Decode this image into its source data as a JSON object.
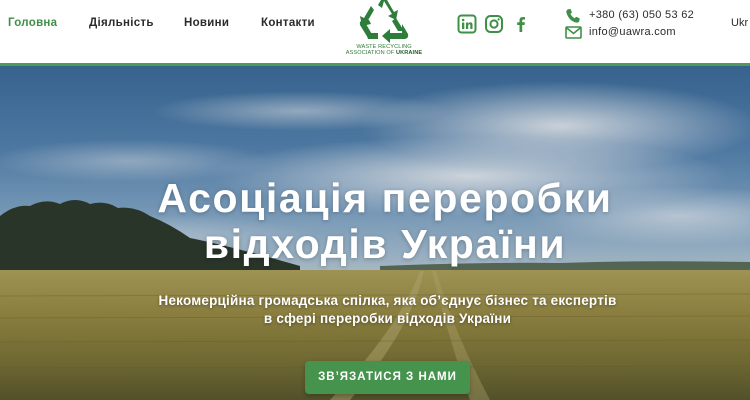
{
  "nav": {
    "items": [
      {
        "label": "Головна"
      },
      {
        "label": "Діяльність"
      },
      {
        "label": "Новини"
      },
      {
        "label": "Контакти"
      }
    ],
    "active_index": 0
  },
  "logo": {
    "line1": "WASTE RECYCLING",
    "line2_prefix": "ASSOCIATION OF",
    "line2_bold": "UKRAINE",
    "icon": "recycle-icon"
  },
  "social": [
    {
      "icon": "linkedin-icon"
    },
    {
      "icon": "instagram-icon"
    },
    {
      "icon": "facebook-icon"
    }
  ],
  "contacts": {
    "phone": "+380 (63) 050 53 62",
    "email": "info@uawra.com",
    "phone_icon": "phone-icon",
    "email_icon": "mail-icon"
  },
  "language": {
    "current": "Ukr"
  },
  "hero": {
    "title_line1": "Асоціація переробки",
    "title_line2": "відходів України",
    "subtitle_line1": "Некомерційна громадська спілка, яка об’єднує бізнес та експертів",
    "subtitle_line2": "в сфері переробки відходів України",
    "cta_label": "ЗВ’ЯЗАТИСЯ З НАМИ"
  },
  "colors": {
    "accent_green": "#45934d",
    "active_nav": "#3f8f47",
    "header_border": "#4e9a59",
    "sky_blue": "#5887b3",
    "field_gold": "#a99b4f"
  }
}
